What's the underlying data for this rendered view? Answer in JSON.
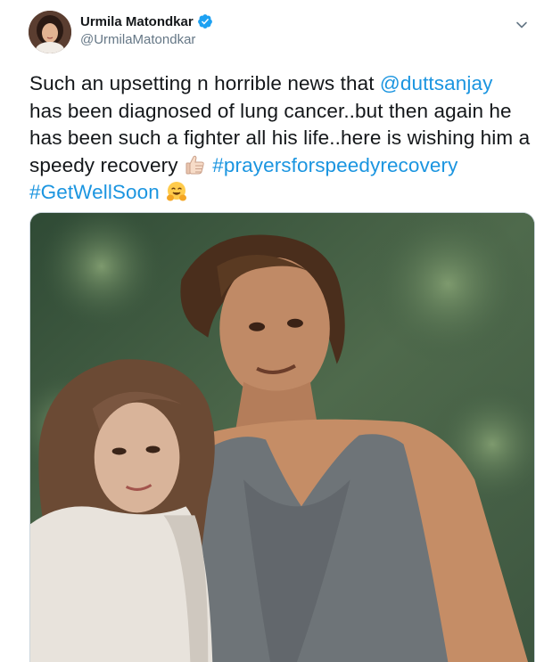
{
  "tweet": {
    "author": {
      "display_name": "Urmila Matondkar",
      "handle": "@UrmilaMatondkar",
      "verified": true
    },
    "text_lines": [
      [
        {
          "text": "Such an upsetting n horrible news that "
        },
        {
          "text": "@duttsanjay",
          "type": "mention"
        }
      ],
      [
        {
          "text": "has been diagnosed of lung cancer..but then again he"
        }
      ],
      [
        {
          "text": "has been such a fighter all his life..here is wishing him a"
        }
      ],
      [
        {
          "text": "speedy recovery "
        },
        {
          "emoji": "thumbs-up-emoji"
        },
        {
          "text": " "
        },
        {
          "text": "#prayersforspeedyrecovery",
          "type": "hashtag"
        }
      ],
      [
        {
          "text": "#GetWellSoon",
          "type": "hashtag"
        },
        {
          "text": " "
        },
        {
          "emoji": "hugging-face-emoji"
        }
      ]
    ],
    "media": {
      "kind": "photo"
    }
  },
  "colors": {
    "link": "#1b95e0",
    "verified_badge": "#1da1f2",
    "secondary_text": "#657786",
    "primary_text": "#14171a",
    "border": "#ccd6dd"
  },
  "icons": [
    "verified-badge-icon",
    "chevron-down-icon",
    "thumbs-up-emoji",
    "hugging-face-emoji"
  ]
}
